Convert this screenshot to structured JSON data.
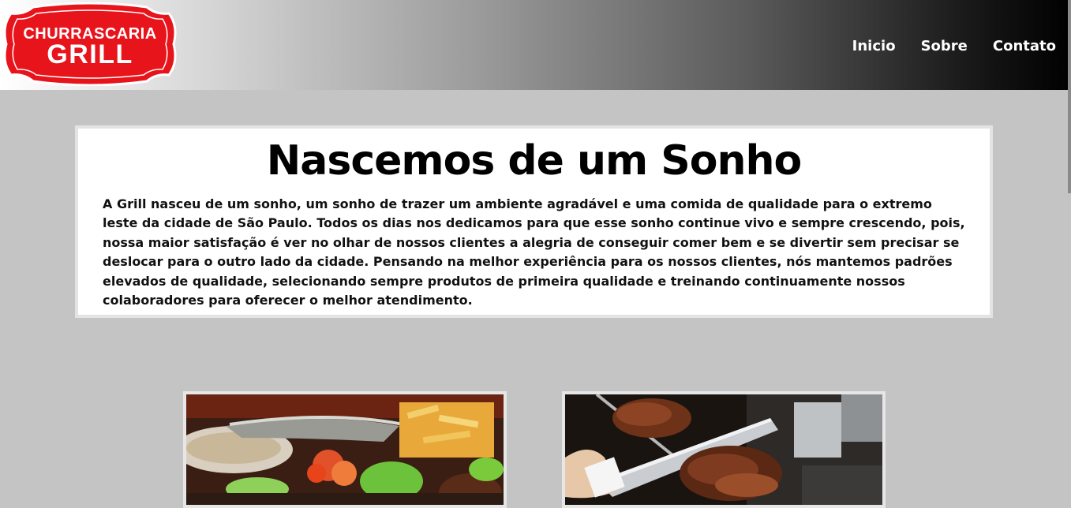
{
  "header": {
    "logo": {
      "line1": "CHURRASCARIA",
      "line2": "GRILL",
      "brand_color": "#e8141c"
    },
    "nav": [
      {
        "label": "Inicio"
      },
      {
        "label": "Sobre"
      },
      {
        "label": "Contato"
      }
    ]
  },
  "about": {
    "title": "Nascemos de um Sonho",
    "text": "A Grill nasceu de um sonho, um sonho de trazer um ambiente agradável e uma comida de qualidade para o extremo leste da cidade de São Paulo. Todos os dias nos dedicamos para que esse sonho continue vivo e sempre crescendo, pois, nossa maior satisfação é ver no olhar de nossos clientes a alegria de conseguir comer bem e se divertir sem precisar se deslocar para o outro lado da cidade. Pensando na melhor experiência para os nossos clientes, nós mantemos padrões elevados de qualidade, selecionando sempre produtos de primeira qualidade e treinando continuamente nossos colaboradores para oferecer o melhor atendimento."
  },
  "gallery": [
    {
      "icon": "food-plate-photo"
    },
    {
      "icon": "meat-carving-photo"
    }
  ]
}
